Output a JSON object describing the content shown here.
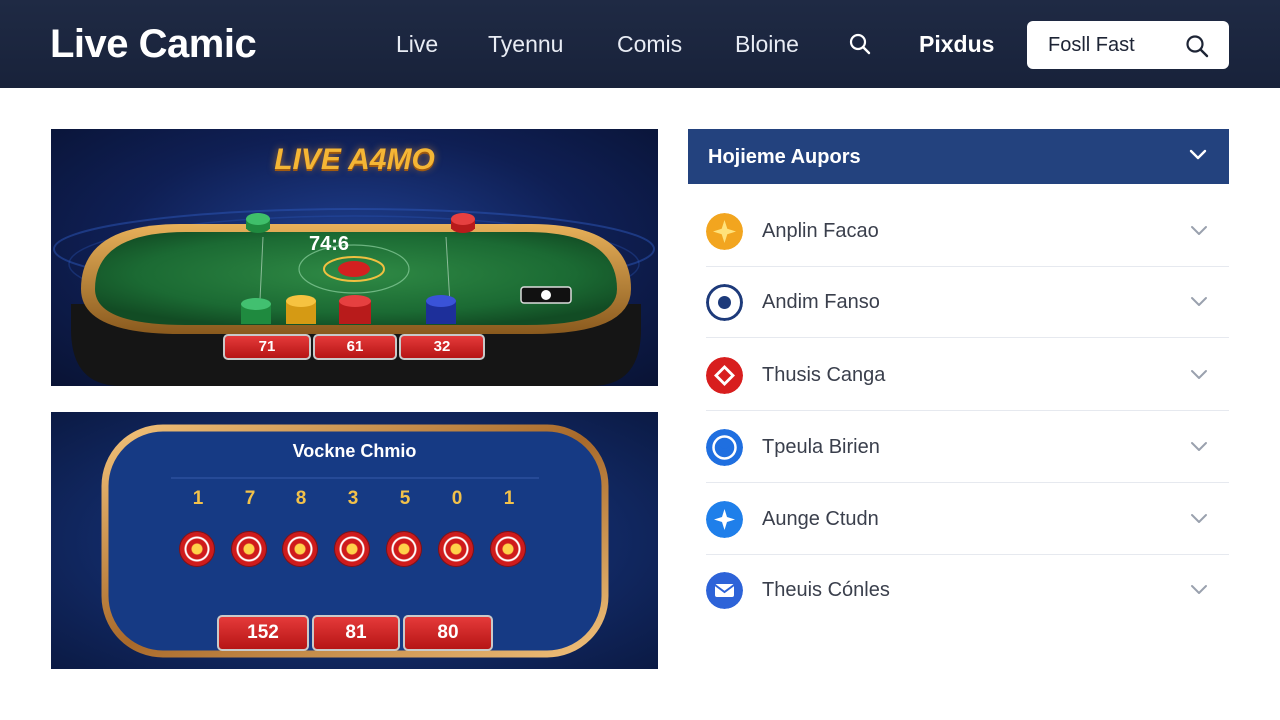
{
  "header": {
    "logo": "Live Camic",
    "nav": [
      "Live",
      "Tyennu",
      "Comis",
      "Bloine"
    ],
    "nav_strong": "Pixdus",
    "search": {
      "value": "Fosll Fast",
      "icon": "search-icon"
    },
    "nav_search_icon": "search-icon"
  },
  "games": {
    "featured": {
      "title": "LIVE A4MO",
      "table_number": "74:6",
      "scores": [
        "71",
        "61",
        "32"
      ]
    },
    "secondary": {
      "title": "Vockne Chmio",
      "digits": [
        "1",
        "7",
        "8",
        "3",
        "5",
        "0",
        "1"
      ],
      "scores": [
        "152",
        "81",
        "80"
      ]
    }
  },
  "panel": {
    "title": "Hojieme Aupors",
    "items": [
      {
        "label": "Anplin Facao",
        "icon": "star-icon",
        "color": "#f2a51f"
      },
      {
        "label": "Andim Fanso",
        "icon": "target-icon",
        "color": "#1d3a7a"
      },
      {
        "label": "Thusis Canga",
        "icon": "diamond-icon",
        "color": "#d81e1e"
      },
      {
        "label": "Tpeula Birien",
        "icon": "check-circle-icon",
        "color": "#1f6fe0"
      },
      {
        "label": "Aunge Ctudn",
        "icon": "sparkle-icon",
        "color": "#1f7fea"
      },
      {
        "label": "Theuis Cónles",
        "icon": "mail-icon",
        "color": "#2d63d8"
      }
    ]
  },
  "colors": {
    "header_bg": "#1f2a44",
    "panel_head": "#23427e",
    "accent_red": "#c81e1e",
    "gold": "#f5b635"
  }
}
